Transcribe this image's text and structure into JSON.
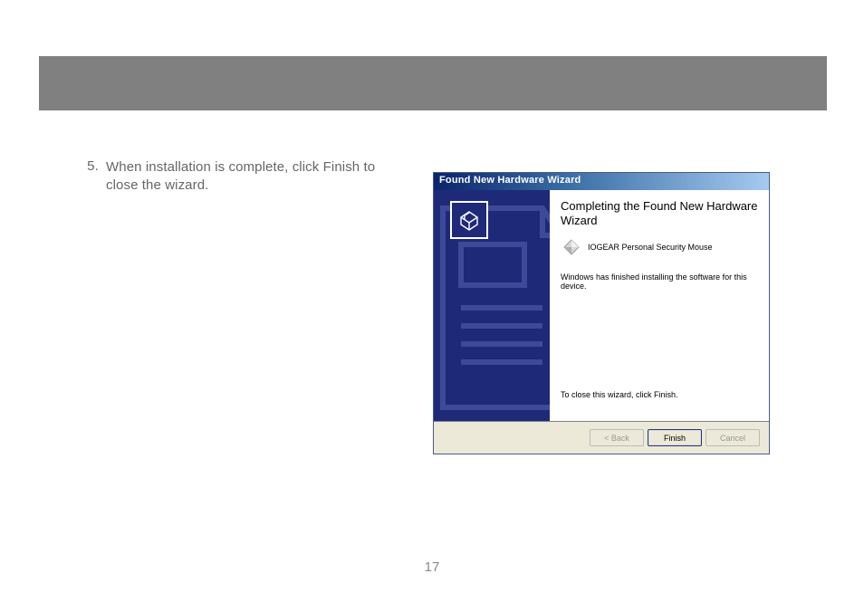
{
  "header": {
    "title": ""
  },
  "instruction": {
    "number": "5.",
    "text": "When installation is complete, click Finish to close the wizard."
  },
  "dialog": {
    "title": "Found New Hardware Wizard",
    "heading": "Completing the Found New Hardware Wizard",
    "device_name": "IOGEAR Personal Security Mouse",
    "finished_text": "Windows has finished installing the software for this device.",
    "close_text": "To close this wizard, click Finish.",
    "buttons": {
      "back": "< Back",
      "finish": "Finish",
      "cancel": "Cancel"
    }
  },
  "page_number": "17"
}
